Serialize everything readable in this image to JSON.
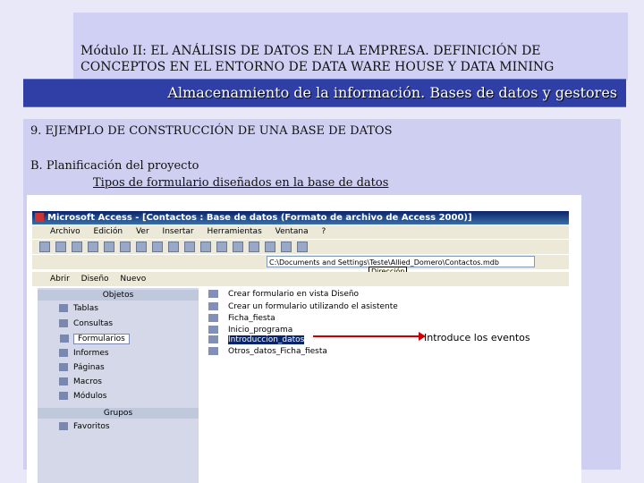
{
  "slide": {
    "header_line1": "Módulo II: EL ANÁLISIS DE DATOS EN LA EMPRESA. DEFINICIÓN DE",
    "header_line2": "CONCEPTOS EN EL ENTORNO DE DATA WARE HOUSE Y DATA MINING",
    "band_title": "Almacenamiento de la información. Bases de datos y gestores",
    "section": "9. EJEMPLO DE CONSTRUCCIÓN DE UNA BASE DE DATOS",
    "subsection": "B. Planificación del proyecto",
    "subsubsection": "Tipos de formulario diseñados en la base de datos"
  },
  "access": {
    "window_title": "Microsoft Access - [Contactos : Base de datos (Formato de archivo de Access 2000)]",
    "menu": [
      "Archivo",
      "Edición",
      "Ver",
      "Insertar",
      "Herramientas",
      "Ventana",
      "?"
    ],
    "address": "C:\\Documents and Settings\\Teste\\Allied_Domero\\Contactos.mdb",
    "tooltip": "Dirección",
    "subtoolbar": [
      "Abrir",
      "Diseño",
      "Nuevo"
    ],
    "objects_header": "Objetos",
    "objects": [
      "Tablas",
      "Consultas",
      "Formularios",
      "Informes",
      "Páginas",
      "Macros",
      "Módulos"
    ],
    "groups_header": "Grupos",
    "groups": [
      "Favoritos"
    ],
    "items": [
      "Crear formulario en vista Diseño",
      "Crear un formulario utilizando el asistente",
      "Ficha_fiesta",
      "Inicio_programa",
      "Introduccion_datos",
      "Otros_datos_Ficha_fiesta"
    ]
  },
  "annotation": "Introduce los eventos"
}
